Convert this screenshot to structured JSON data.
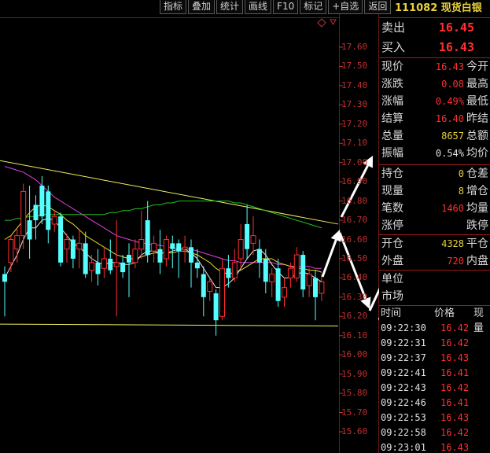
{
  "toolbar": [
    "指标",
    "叠加",
    "统计",
    "画线",
    "F10",
    "标记",
    "+自选",
    "返回"
  ],
  "chart_data": {
    "type": "candlestick",
    "y_ticks": [
      "17.60",
      "17.50",
      "17.40",
      "17.30",
      "17.20",
      "17.10",
      "17.00",
      "16.90",
      "16.80",
      "16.70",
      "16.60",
      "16.50",
      "16.40",
      "16.30",
      "16.20",
      "16.10",
      "16.00",
      "15.90",
      "15.80",
      "15.70",
      "15.60"
    ],
    "ylim": [
      15.55,
      17.7
    ],
    "candles": [
      {
        "o": 16.42,
        "c": 16.38,
        "h": 16.46,
        "l": 16.2,
        "up": false
      },
      {
        "o": 16.48,
        "c": 16.6,
        "h": 16.62,
        "l": 16.43,
        "up": true
      },
      {
        "o": 16.55,
        "c": 16.62,
        "h": 16.66,
        "l": 16.48,
        "up": true
      },
      {
        "o": 16.62,
        "c": 16.85,
        "h": 16.89,
        "l": 16.55,
        "up": true
      },
      {
        "o": 16.7,
        "c": 16.6,
        "h": 16.88,
        "l": 16.5,
        "up": false
      },
      {
        "o": 16.78,
        "c": 16.7,
        "h": 16.83,
        "l": 16.6,
        "up": false
      },
      {
        "o": 16.88,
        "c": 16.72,
        "h": 16.93,
        "l": 16.68,
        "up": false
      },
      {
        "o": 16.85,
        "c": 16.65,
        "h": 16.88,
        "l": 16.58,
        "up": false
      },
      {
        "o": 16.68,
        "c": 16.72,
        "h": 16.75,
        "l": 16.64,
        "up": true
      },
      {
        "o": 16.72,
        "c": 16.48,
        "h": 16.74,
        "l": 16.46,
        "up": false
      },
      {
        "o": 16.55,
        "c": 16.6,
        "h": 16.63,
        "l": 16.48,
        "up": true
      },
      {
        "o": 16.6,
        "c": 16.5,
        "h": 16.62,
        "l": 16.45,
        "up": false
      },
      {
        "o": 16.55,
        "c": 16.58,
        "h": 16.65,
        "l": 16.45,
        "up": true
      },
      {
        "o": 16.58,
        "c": 16.42,
        "h": 16.64,
        "l": 16.4,
        "up": false
      },
      {
        "o": 16.44,
        "c": 16.48,
        "h": 16.52,
        "l": 16.38,
        "up": true
      },
      {
        "o": 16.48,
        "c": 16.42,
        "h": 16.55,
        "l": 16.36,
        "up": false
      },
      {
        "o": 16.45,
        "c": 16.5,
        "h": 16.56,
        "l": 16.4,
        "up": true
      },
      {
        "o": 16.5,
        "c": 16.44,
        "h": 16.6,
        "l": 16.42,
        "up": false
      },
      {
        "o": 16.46,
        "c": 16.48,
        "h": 16.7,
        "l": 16.2,
        "up": true
      },
      {
        "o": 16.48,
        "c": 16.43,
        "h": 16.52,
        "l": 16.4,
        "up": false
      },
      {
        "o": 16.52,
        "c": 16.48,
        "h": 16.58,
        "l": 16.3,
        "up": false
      },
      {
        "o": 16.48,
        "c": 16.55,
        "h": 16.6,
        "l": 16.45,
        "up": true
      },
      {
        "o": 16.55,
        "c": 16.6,
        "h": 16.75,
        "l": 16.5,
        "up": true
      },
      {
        "o": 16.7,
        "c": 16.52,
        "h": 16.8,
        "l": 16.48,
        "up": false
      },
      {
        "o": 16.54,
        "c": 16.58,
        "h": 16.62,
        "l": 16.48,
        "up": true
      },
      {
        "o": 16.55,
        "c": 16.48,
        "h": 16.65,
        "l": 16.42,
        "up": false
      },
      {
        "o": 16.5,
        "c": 16.6,
        "h": 16.62,
        "l": 16.46,
        "up": true
      },
      {
        "o": 16.58,
        "c": 16.55,
        "h": 16.62,
        "l": 16.45,
        "up": false
      },
      {
        "o": 16.58,
        "c": 16.54,
        "h": 16.6,
        "l": 16.4,
        "up": false
      },
      {
        "o": 16.55,
        "c": 16.56,
        "h": 16.62,
        "l": 16.48,
        "up": true
      },
      {
        "o": 16.56,
        "c": 16.48,
        "h": 16.6,
        "l": 16.35,
        "up": false
      },
      {
        "o": 16.48,
        "c": 16.45,
        "h": 16.55,
        "l": 16.4,
        "up": false
      },
      {
        "o": 16.42,
        "c": 16.3,
        "h": 16.46,
        "l": 16.2,
        "up": false
      },
      {
        "o": 16.33,
        "c": 16.38,
        "h": 16.4,
        "l": 16.28,
        "up": true
      },
      {
        "o": 16.32,
        "c": 16.18,
        "h": 16.34,
        "l": 16.1,
        "up": false
      },
      {
        "o": 16.2,
        "c": 16.45,
        "h": 16.5,
        "l": 16.18,
        "up": true
      },
      {
        "o": 16.45,
        "c": 16.4,
        "h": 16.52,
        "l": 16.35,
        "up": false
      },
      {
        "o": 16.4,
        "c": 16.48,
        "h": 16.55,
        "l": 16.38,
        "up": true
      },
      {
        "o": 16.5,
        "c": 16.6,
        "h": 16.68,
        "l": 16.45,
        "up": true
      },
      {
        "o": 16.68,
        "c": 16.55,
        "h": 16.78,
        "l": 16.5,
        "up": false
      },
      {
        "o": 16.58,
        "c": 16.62,
        "h": 16.72,
        "l": 16.52,
        "up": true
      },
      {
        "o": 16.55,
        "c": 16.48,
        "h": 16.6,
        "l": 16.4,
        "up": false
      },
      {
        "o": 16.5,
        "c": 16.38,
        "h": 16.55,
        "l": 16.32,
        "up": false
      },
      {
        "o": 16.38,
        "c": 16.42,
        "h": 16.45,
        "l": 16.3,
        "up": true
      },
      {
        "o": 16.45,
        "c": 16.28,
        "h": 16.5,
        "l": 16.25,
        "up": false
      },
      {
        "o": 16.3,
        "c": 16.35,
        "h": 16.4,
        "l": 16.25,
        "up": true
      },
      {
        "o": 16.4,
        "c": 16.45,
        "h": 16.48,
        "l": 16.35,
        "up": true
      },
      {
        "o": 16.4,
        "c": 16.52,
        "h": 16.56,
        "l": 16.38,
        "up": true
      },
      {
        "o": 16.52,
        "c": 16.34,
        "h": 16.54,
        "l": 16.3,
        "up": false
      },
      {
        "o": 16.36,
        "c": 16.42,
        "h": 16.45,
        "l": 16.3,
        "up": true
      },
      {
        "o": 16.4,
        "c": 16.3,
        "h": 16.44,
        "l": 16.18,
        "up": false
      },
      {
        "o": 16.32,
        "c": 16.38,
        "h": 16.42,
        "l": 16.28,
        "up": true
      }
    ],
    "x_start": 6,
    "x_step": 7.9,
    "ma_white": [
      16.4,
      16.46,
      16.52,
      16.6,
      16.66,
      16.66,
      16.7,
      16.71,
      16.7,
      16.66,
      16.62,
      16.58,
      16.56,
      16.53,
      16.5,
      16.48,
      16.47,
      16.48,
      16.48,
      16.47,
      16.47,
      16.48,
      16.52,
      16.54,
      16.54,
      16.53,
      16.53,
      16.54,
      16.55,
      16.55,
      16.53,
      16.5,
      16.45,
      16.4,
      16.35,
      16.35,
      16.37,
      16.4,
      16.45,
      16.5,
      16.54,
      16.55,
      16.52,
      16.47,
      16.43,
      16.4,
      16.4,
      16.42,
      16.43,
      16.42,
      16.4,
      16.38
    ],
    "ma_yellow": [
      16.6,
      16.62,
      16.66,
      16.7,
      16.74,
      16.77,
      16.78,
      16.77,
      16.75,
      16.73,
      16.7,
      16.68,
      16.65,
      16.62,
      16.6,
      16.58,
      16.56,
      16.54,
      16.52,
      16.51,
      16.5,
      16.5,
      16.51,
      16.52,
      16.53,
      16.53,
      16.53,
      16.53,
      16.54,
      16.54,
      16.53,
      16.52,
      16.5,
      16.48,
      16.45,
      16.43,
      16.42,
      16.43,
      16.44,
      16.46,
      16.48,
      16.5,
      16.5,
      16.5,
      16.48,
      16.47,
      16.46,
      16.45,
      16.45,
      16.44,
      16.44,
      16.43
    ],
    "ma_magenta": [
      16.98,
      16.97,
      16.96,
      16.95,
      16.93,
      16.91,
      16.88,
      16.85,
      16.82,
      16.8,
      16.78,
      16.76,
      16.74,
      16.72,
      16.7,
      16.68,
      16.66,
      16.64,
      16.62,
      16.61,
      16.6,
      16.59,
      16.58,
      16.58,
      16.57,
      16.57,
      16.56,
      16.56,
      16.55,
      16.55,
      16.55,
      16.54,
      16.53,
      16.52,
      16.51,
      16.5,
      16.49,
      16.49,
      16.48,
      16.48,
      16.48,
      16.48,
      16.48,
      16.48,
      16.47,
      16.47,
      16.46,
      16.46,
      16.46,
      16.46,
      16.45,
      16.45
    ],
    "ma_green": [
      16.7,
      16.7,
      16.71,
      16.71,
      16.72,
      16.72,
      16.73,
      16.73,
      16.73,
      16.73,
      16.73,
      16.73,
      16.73,
      16.73,
      16.73,
      16.73,
      16.73,
      16.74,
      16.74,
      16.75,
      16.75,
      16.76,
      16.76,
      16.77,
      16.78,
      16.78,
      16.79,
      16.79,
      16.8,
      16.8,
      16.8,
      16.8,
      16.8,
      16.8,
      16.8,
      16.8,
      16.8,
      16.79,
      16.79,
      16.78,
      16.77,
      16.76,
      16.75,
      16.74,
      16.73,
      16.72,
      16.71,
      16.7,
      16.69,
      16.68,
      16.67,
      16.66
    ],
    "trend_top": [
      [
        0,
        17.01
      ],
      [
        430,
        16.68
      ]
    ],
    "trend_bottom": [
      [
        0,
        16.16
      ],
      [
        430,
        16.15
      ]
    ],
    "colors": {
      "up": "#ff2d2d",
      "down": "#54ffff",
      "ma_white": "#e8e8e8",
      "ma_yellow": "#e8e020",
      "ma_magenta": "#e040e0",
      "ma_green": "#20c020",
      "trend_top": "#f0f060",
      "trend_bottom": "#f0f060",
      "arrow": "#ffffff",
      "grid": "#6a1818"
    }
  },
  "panel": {
    "code_name": "111082 现货白银",
    "sell": {
      "label": "卖出",
      "value": "16.45"
    },
    "buy": {
      "label": "买入",
      "value": "16.43"
    },
    "rows1": [
      {
        "label": "现价",
        "value": "16.43",
        "color": "red",
        "r2": "今开"
      },
      {
        "label": "涨跌",
        "value": "0.08",
        "color": "red",
        "r2": "最高"
      },
      {
        "label": "涨幅",
        "value": "0.49%",
        "color": "red",
        "r2": "最低"
      },
      {
        "label": "结算",
        "value": "16.40",
        "color": "red",
        "r2": "昨结"
      },
      {
        "label": "总量",
        "value": "8657",
        "color": "yellow",
        "r2": "总额"
      },
      {
        "label": "振幅",
        "value": "0.54%",
        "color": "white",
        "r2": "均价"
      }
    ],
    "rows2": [
      {
        "label": "持仓",
        "value": "0",
        "color": "yellow",
        "r2": "仓差"
      },
      {
        "label": "现量",
        "value": "8",
        "color": "yellow",
        "r2": "增仓"
      },
      {
        "label": "笔数",
        "value": "1460",
        "color": "red",
        "r2": "均量"
      },
      {
        "label": "涨停",
        "value": "",
        "color": "white",
        "r2": "跌停"
      }
    ],
    "rows3": [
      {
        "label": "开仓",
        "value": "4328",
        "color": "yellow",
        "r2": "平仓"
      },
      {
        "label": "外盘",
        "value": "720",
        "color": "red",
        "r2": "内盘"
      }
    ],
    "rows4": [
      {
        "label": "单位",
        "value": "",
        "color": "white",
        "r2": ""
      },
      {
        "label": "市场",
        "value": "",
        "color": "white",
        "r2": ""
      }
    ],
    "trade_header": {
      "time": "时间",
      "price": "价格",
      "vol": "现量"
    },
    "trades": [
      {
        "time": "09:22:30",
        "price": "16.42"
      },
      {
        "time": "09:22:31",
        "price": "16.42"
      },
      {
        "time": "09:22:37",
        "price": "16.43"
      },
      {
        "time": "09:22:41",
        "price": "16.41"
      },
      {
        "time": "09:22:43",
        "price": "16.42"
      },
      {
        "time": "09:22:46",
        "price": "16.41"
      },
      {
        "time": "09:22:53",
        "price": "16.43"
      },
      {
        "time": "09:22:58",
        "price": "16.42"
      },
      {
        "time": "09:23:01",
        "price": "16.43"
      }
    ]
  }
}
